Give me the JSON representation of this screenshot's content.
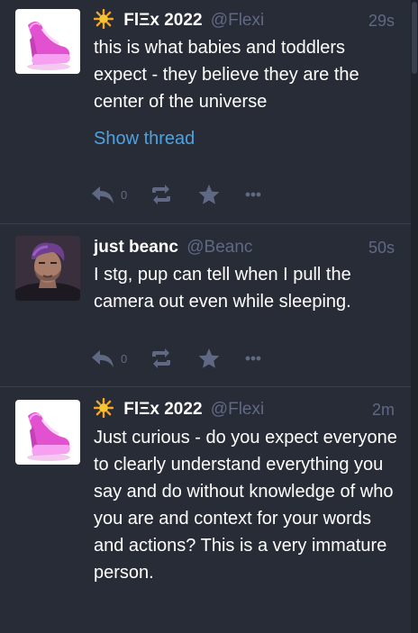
{
  "statuses": [
    {
      "display_name": "FlΞx 2022",
      "username": "@Flexi",
      "timestamp": "29s",
      "content": "this is what babies and toddlers expect - they believe they are the center of the universe",
      "show_thread": "Show thread",
      "reply_count": "0",
      "has_sun_emoji": true,
      "avatar": "pink-high-heel-shoe"
    },
    {
      "display_name": "just beanc",
      "username": "@Beanc",
      "timestamp": "50s",
      "content": "I stg, pup can tell when I pull the camera out even while sleeping.",
      "reply_count": "0",
      "has_sun_emoji": false,
      "avatar": "purple-haired-man"
    },
    {
      "display_name": "FlΞx 2022",
      "username": "@Flexi",
      "timestamp": "2m",
      "content": "Just curious - do you expect everyone to clearly understand everything you say and do without knowledge of who you are and context for your words and actions? This is a very immature person.",
      "has_sun_emoji": true,
      "avatar": "pink-high-heel-shoe"
    }
  ],
  "colors": {
    "background": "#282c37",
    "text": "#ffffff",
    "muted": "#606984",
    "link": "#4ea2df",
    "divider": "#393f4f"
  },
  "icons": [
    "sun-emoji-icon",
    "reply-icon",
    "boost-icon",
    "favourite-icon",
    "more-icon"
  ]
}
